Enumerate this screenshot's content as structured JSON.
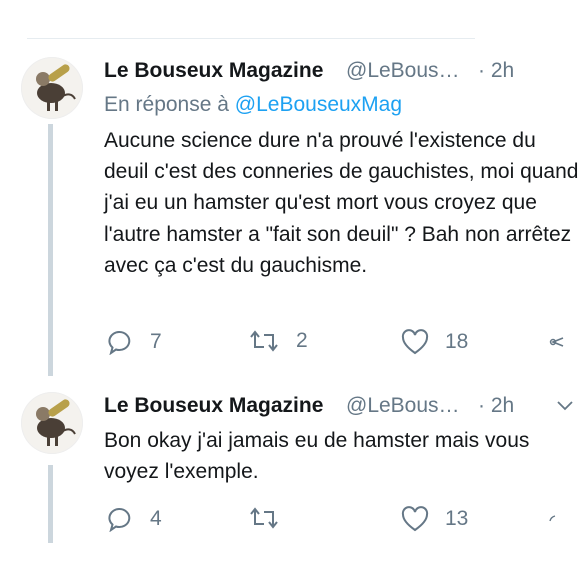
{
  "tweets": [
    {
      "name": "Le Bouseux Magazine",
      "handle": "@LeBous…",
      "time": "· 2h",
      "reply_prefix": "En réponse à",
      "reply_to": "@LeBouseuxMag",
      "text": "Aucune science dure n'a prouvé l'existence du deuil c'est des conneries de gauchistes, moi quand j'ai eu un hamster qu'est mort vous croyez que l'autre hamster a \"fait son deuil\" ? Bah non arrêtez avec ça c'est du gauchisme.",
      "replies": "7",
      "retweets": "2",
      "likes": "18"
    },
    {
      "name": "Le Bouseux Magazine",
      "handle": "@LeBous…",
      "time": "· 2h",
      "text": "Bon okay j'ai jamais eu de hamster mais vous voyez l'exemple.",
      "replies": "4",
      "retweets": "",
      "likes": "13"
    }
  ],
  "colors": {
    "link": "#1da1f2",
    "muted": "#657786",
    "thread_line": "#ccd6dd"
  },
  "icons": [
    "reply-icon",
    "retweet-icon",
    "like-icon",
    "share-icon",
    "chevron-down-icon"
  ]
}
